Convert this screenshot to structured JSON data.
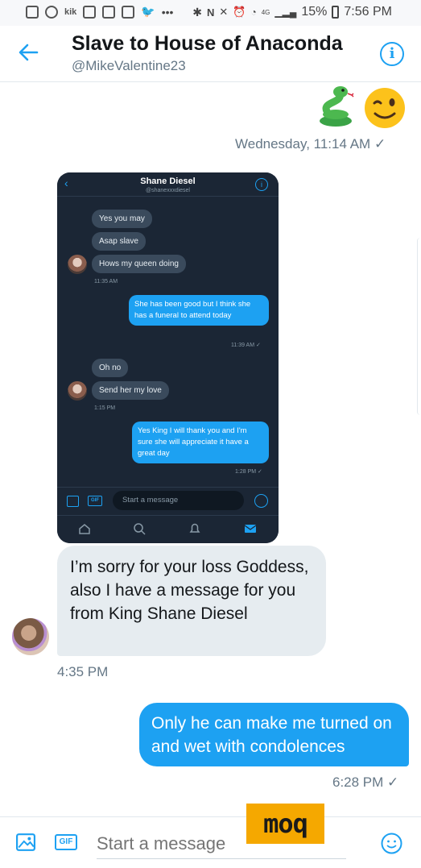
{
  "status_bar": {
    "kik": "kik",
    "battery": "15%",
    "time": "7:56 PM",
    "network": "4G"
  },
  "header": {
    "title": "Slave to House of Anaconda",
    "handle": "@MikeValentine23"
  },
  "messages": {
    "emoji_time": "Wednesday, 11:14 AM ✓",
    "incoming_text": "I’m sorry for your loss Goddess, also I have a message for you from King Shane Diesel",
    "incoming_time": "4:35 PM",
    "outgoing_text": "Only he can make me turned on and wet with condolences",
    "outgoing_time": "6:28 PM ✓"
  },
  "embedded": {
    "name": "Shane Diesel",
    "handle": "@shanexxxdiesel",
    "in1": "Yes you may",
    "in2": "Asap slave",
    "in3": "Hows my queen doing",
    "t1": "11:35 AM",
    "out1": "She has been good but I think she has a funeral to attend today",
    "t2": "11:39 AM ✓",
    "in4": "Oh no",
    "in5": "Send her my love",
    "t3": "1:15 PM",
    "out2": "Yes King I will thank you and I'm sure she will appreciate it have a great day",
    "t4": "1:28 PM ✓",
    "gif": "GIF",
    "placeholder": "Start a message"
  },
  "compose": {
    "gif": "GIF",
    "placeholder": "Start a message"
  },
  "watermark": "moq",
  "colors": {
    "accent": "#1da1f2",
    "incoming_bubble": "#e6ecf0",
    "embed_bg": "#1b2635"
  },
  "icons": [
    "back-arrow-icon",
    "info-icon",
    "snake-emoji",
    "wink-emoji",
    "image-icon",
    "gif-icon",
    "emoji-icon"
  ]
}
